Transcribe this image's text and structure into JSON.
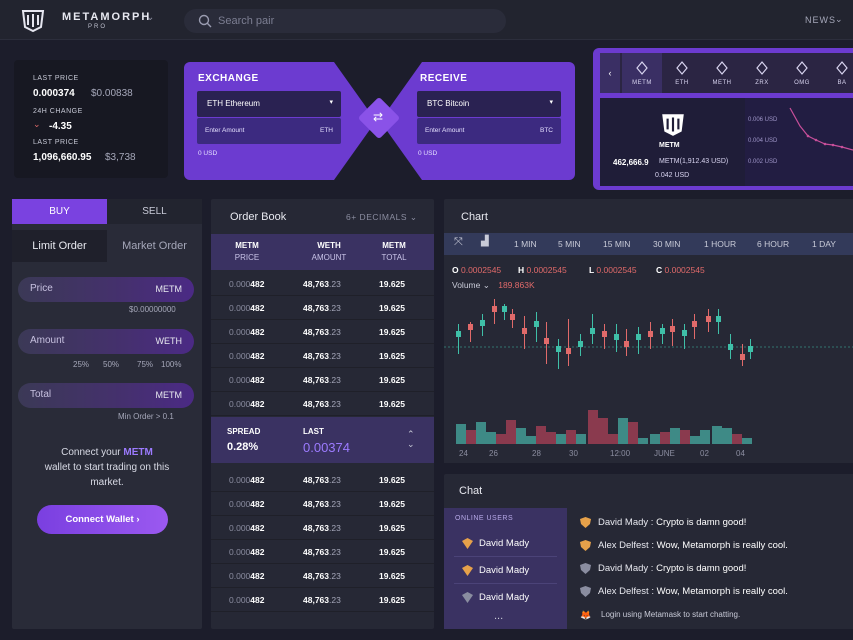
{
  "header": {
    "brand": "METAMORPH",
    "brand_sub": "PRO",
    "search_placeholder": "Search pair",
    "news": "NEWS"
  },
  "stats": {
    "last_price_label": "LAST PRICE",
    "last_price": "0.000374",
    "last_price_usd": "$0.00838",
    "change_label": "24H CHANGE",
    "change": "-4.35",
    "last_price2_label": "LAST PRICE",
    "last_price2": "1,096,660.95",
    "last_price2_usd": "$3,738"
  },
  "exchange": {
    "title": "EXCHANGE",
    "coin": "ETH Ethereum",
    "amount_placeholder": "Enter Amount",
    "unit": "ETH",
    "usd": "0 USD"
  },
  "receive": {
    "title": "RECEIVE",
    "coin": "BTC Bitcoin",
    "amount_placeholder": "Enter Amount",
    "unit": "BTC",
    "usd": "0 USD"
  },
  "coins": [
    {
      "label": "METM",
      "icon": "metm-icon"
    },
    {
      "label": "ETH",
      "icon": "eth-icon"
    },
    {
      "label": "METH",
      "icon": "meth-icon"
    },
    {
      "label": "ZRX",
      "icon": "zrx-icon"
    },
    {
      "label": "OMG",
      "icon": "omg-icon"
    },
    {
      "label": "BA",
      "icon": "bat-icon"
    }
  ],
  "coin_detail": {
    "name": "METM",
    "amount": "462,666.9",
    "metm_usd": "METM(1,912.43 USD)",
    "btc": "0.042 USD",
    "axis": [
      "0.006 USD",
      "0.004 USD",
      "0.002 USD"
    ]
  },
  "trade": {
    "buy": "BUY",
    "sell": "SELL",
    "limit": "Limit Order",
    "market": "Market Order",
    "price_label": "Price",
    "price_unit": "METM",
    "price_hint": "$0.00000000",
    "amount_label": "Amount",
    "amount_unit": "WETH",
    "pcts": [
      "25%",
      "50%",
      "75%",
      "100%"
    ],
    "total_label": "Total",
    "total_unit": "METM",
    "min_order": "Min Order > 0.1",
    "connect_pre": "Connect your ",
    "connect_coin": "METM",
    "connect_post": "wallet to start trading on this market.",
    "connect_btn": "Connect Wallet ›"
  },
  "orderbook": {
    "title": "Order Book",
    "decimals": "6+ DECIMALS",
    "cols": [
      {
        "a": "METM",
        "b": "PRICE"
      },
      {
        "a": "WETH",
        "b": "AMOUNT"
      },
      {
        "a": "METM",
        "b": "TOTAL"
      }
    ],
    "row": {
      "p1": "0.000",
      "p2": "482",
      "a1": "48,763",
      "a2": ".23",
      "t": "19.625"
    },
    "spread_label": "SPREAD",
    "spread": "0.28%",
    "last_label": "LAST",
    "last": "0.00374"
  },
  "chart": {
    "title": "Chart",
    "timeframes": [
      "1 MIN",
      "5 MIN",
      "15 MIN",
      "30 MIN",
      "1 HOUR",
      "6 HOUR",
      "1 DAY"
    ],
    "o": "0.0002545",
    "h": "0.0002545",
    "l": "0.0002545",
    "c": "0.0002545",
    "volume_label": "Volume",
    "volume": "189.863K",
    "xlabels": [
      "24",
      "26",
      "28",
      "30",
      "12:00",
      "JUNE",
      "02",
      "04"
    ]
  },
  "chat": {
    "title": "Chat",
    "online": "ONLINE USERS",
    "users": [
      "David Mady",
      "David Mady",
      "David Mady"
    ],
    "messages": [
      {
        "u": "David Mady :",
        "m": "Crypto is damn good!"
      },
      {
        "u": "Alex Delfest :",
        "m": "Wow, Metamorph is really cool."
      },
      {
        "u": "David Mady :",
        "m": "Crypto is damn good!"
      },
      {
        "u": "Alex Delfest :",
        "m": "Wow, Metamorph is really cool."
      }
    ],
    "login": "Login using Metamask to start chatting.",
    "more": "..."
  },
  "colors": {
    "accent": "#7a42e0",
    "up": "#3fbfa8",
    "down": "#e06a6a"
  }
}
